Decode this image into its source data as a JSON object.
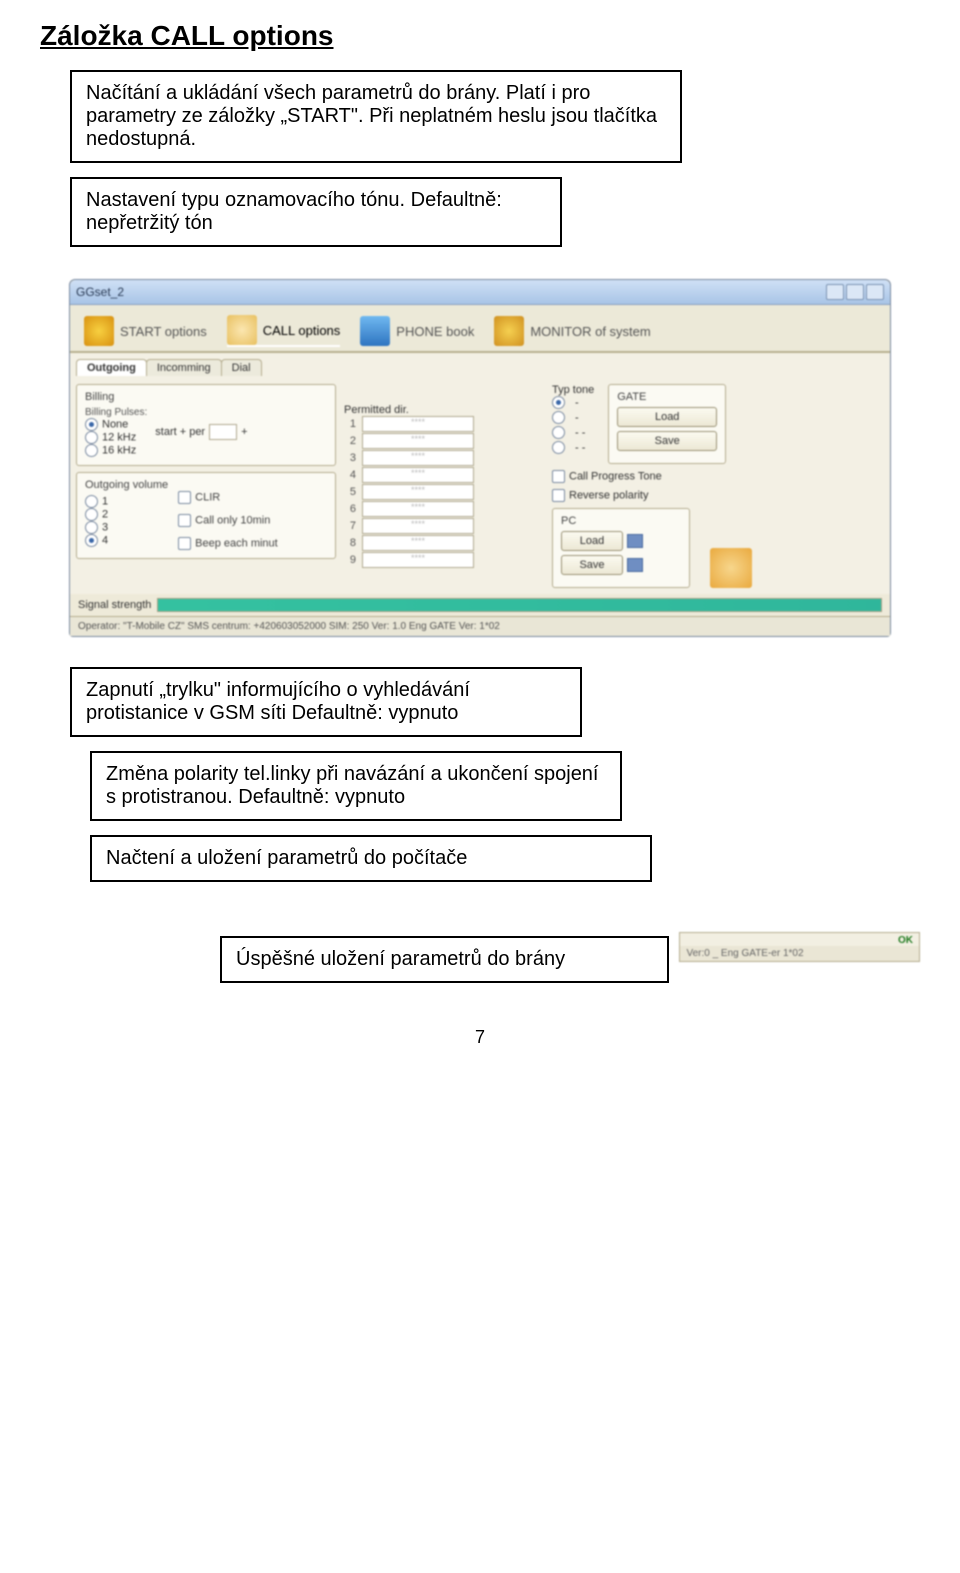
{
  "page_title": "Záložka CALL options",
  "box1": "Načítání a ukládání všech parametrů do brány. Platí i pro parametry ze záložky „START\". Při neplatném heslu jsou tlačítka nedostupná.",
  "box2": "Nastavení typu oznamovacího tónu. Defaultně: nepřetržitý tón",
  "box3": "Zapnutí „trylku\" informujícího o vyhledávání protistanice v GSM síti Defaultně: vypnuto",
  "box4": "Změna polarity tel.linky při navázání  a ukončení spojení s protistranou. Defaultně: vypnuto",
  "box5": "Načtení a uložení parametrů do počítače",
  "box6": "Úspěšné uložení parametrů do brány",
  "window": {
    "title": "GGset_2",
    "main_tabs": [
      "START options",
      "CALL options",
      "PHONE book",
      "MONITOR of system"
    ],
    "sub_tabs": [
      "Outgoing",
      "Incomming",
      "Dial"
    ],
    "billing": {
      "title": "Billing",
      "pulses_title": "Billing Pulses:",
      "options": [
        "None",
        "12 kHz",
        "16 kHz"
      ],
      "startper": "start + per"
    },
    "outgoing_volume": {
      "title": "Outgoing volume",
      "options": [
        "1",
        "2",
        "3",
        "4"
      ]
    },
    "clir": "CLIR",
    "callonly": "Call only 10min",
    "beepeach": "Beep each minut",
    "permitted": {
      "title": "Permitted dir.",
      "count": 9,
      "placeholder": "****"
    },
    "typ_tone": {
      "title": "Typ tone",
      "options": [
        "-",
        "-",
        "- -",
        "-  -"
      ]
    },
    "call_progress": "Call Progress Tone",
    "reverse_polarity": "Reverse polarity",
    "gate": {
      "title": "GATE",
      "load": "Load",
      "save": "Save"
    },
    "pc": {
      "title": "PC",
      "load": "Load",
      "save": "Save"
    },
    "signal_label": "Signal strength",
    "statusbar": "Operator: \"T-Mobile CZ\"      SMS centrum: +420603052000   SIM: 250   Ver: 1.0 Eng   GATE Ver: 1*02"
  },
  "small_status": {
    "ok": "OK",
    "line2": "Ver:0 _ Eng  GATE-er 1*02"
  },
  "page_num": "7"
}
